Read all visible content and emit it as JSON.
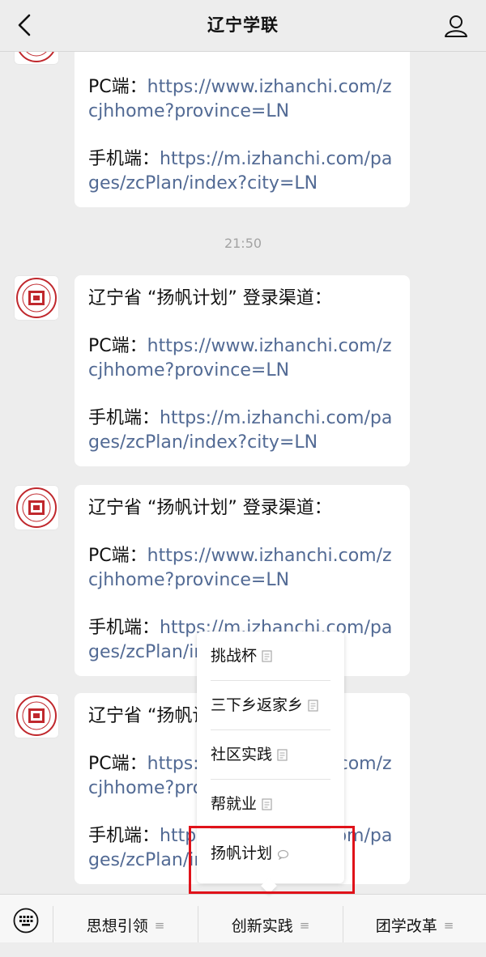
{
  "nav": {
    "title": "辽宁学联",
    "back_icon": "chevron-left-icon",
    "profile_icon": "person-icon"
  },
  "messages": [
    {
      "pc_label": "PC端：",
      "pc_link": "https://www.izhanchi.com/zcjhhome?province=LN",
      "mobile_label": "手机端：",
      "mobile_link": "https://m.izhanchi.com/pages/zcPlan/index?city=LN"
    },
    {
      "heading": "辽宁省 “扬帆计划” 登录渠道：",
      "pc_label": "PC端：",
      "pc_link": "https://www.izhanchi.com/zcjhhome?province=LN",
      "mobile_label": "手机端：",
      "mobile_link": "https://m.izhanchi.com/pages/zcPlan/index?city=LN"
    },
    {
      "heading": "辽宁省 “扬帆计划” 登录渠道：",
      "pc_label": "PC端：",
      "pc_link": "https://www.izhanchi.com/zcjhhome?province=LN",
      "mobile_label": "手机端：",
      "mobile_link": "https://m.izhanchi.com/pages/zcPlan/index?city=LN"
    },
    {
      "heading": "辽宁省 “扬帆计划” 登录渠道：",
      "pc_label": "PC端：",
      "pc_link": "https://www.izhanchi.com/zcjhhome?province=LN",
      "mobile_label": "手机端：",
      "mobile_link": "https://m.izhanchi.com/pages/zcPlan/index?city=LN"
    }
  ],
  "timestamp": "21:50",
  "popup_menu": {
    "items": [
      {
        "label": "挑战杯",
        "icon": "document-icon"
      },
      {
        "label": "三下乡返家乡",
        "icon": "document-icon"
      },
      {
        "label": "社区实践",
        "icon": "document-icon"
      },
      {
        "label": "帮就业",
        "icon": "document-icon"
      },
      {
        "label": "扬帆计划",
        "icon": "speech-bubble-icon"
      }
    ],
    "highlighted": "扬帆计划",
    "highlight_color": "#e0121a"
  },
  "bottom_menu": {
    "keyboard_icon": "keyboard-icon",
    "tabs": [
      {
        "label": "思想引领",
        "icon": "menu-lines-icon"
      },
      {
        "label": "创新实践",
        "icon": "menu-lines-icon"
      },
      {
        "label": "团学改革",
        "icon": "menu-lines-icon"
      }
    ]
  },
  "colors": {
    "background": "#ededed",
    "link": "#526a94",
    "bubble": "#ffffff"
  }
}
